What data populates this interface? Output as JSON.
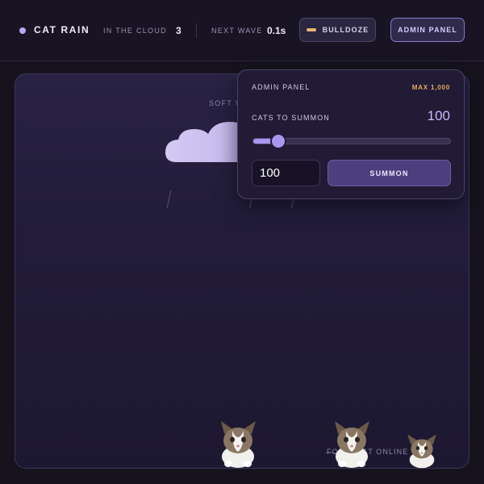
{
  "header": {
    "brand": "CAT RAIN",
    "in_cloud_label": "IN THE CLOUD",
    "in_cloud_value": "3",
    "next_wave_label": "NEXT WAVE",
    "next_wave_value": "0.1s",
    "bulldoze_label": "BULLDOZE",
    "admin_label": "ADMIN PANEL"
  },
  "stage": {
    "caption": "SOFT WAVE",
    "forecast": "FORECAST ONLINE"
  },
  "admin_panel": {
    "title": "ADMIN PANEL",
    "max": "MAX 1,000",
    "cats_label": "CATS TO SUMMON",
    "count": "100",
    "slider_fraction": 0.1,
    "input_value": "100",
    "summon_label": "SUMMON"
  },
  "colors": {
    "background": "#16131f",
    "accent": "#a996f0",
    "warning": "#e8aa5f"
  },
  "icons": {
    "brand": "dot-icon",
    "bulldoze": "bulldozer-blade-icon",
    "cloud": "cloud-icon",
    "cat": "cat-image"
  }
}
